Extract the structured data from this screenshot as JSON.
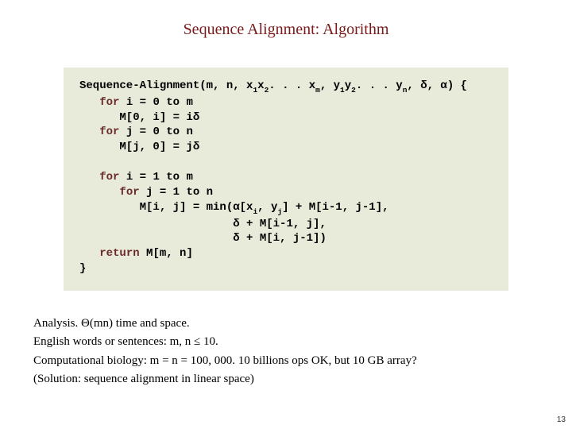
{
  "title": "Sequence Alignment:  Algorithm",
  "code": {
    "fn_name": "Sequence-Alignment",
    "p_open": "(m, n, x",
    "sub1": "1",
    "p_x2": "x",
    "sub2": "2",
    "p_dots_xm": ". . . x",
    "subm": "m",
    "p_comma_y": ", y",
    "suby1": "1",
    "p_y2": "y",
    "suby2": "2",
    "p_dots_yn": ". . . y",
    "subn": "n",
    "p_tail": ", δ, α) {",
    "kw_for": "for",
    "kw_return": "return",
    "l2": " i = 0 to m",
    "l3": "      M[0, i] = iδ",
    "l4": " j = 0 to n",
    "l5": "      M[j, 0] = jδ",
    "l6": " i = 1 to m",
    "l7": " j = 1 to n",
    "l8a": "         M[i, j] = min(α[x",
    "l8_subi": "i",
    "l8b": ", y",
    "l8_subj": "j",
    "l8c": "] + M[i-1, j-1],",
    "l9": "                       δ + M[i-1, j],",
    "l10": "                       δ + M[i, j-1])",
    "l11": " M[m, n]",
    "brace": "}"
  },
  "analysis": {
    "line1a": "Analysis.  Θ(mn) time and space.",
    "line2": "English words or sentences:  m, n  ≤ 10.",
    "line3": "Computational biology:  m = n = 100, 000. 10 billions ops OK, but 10 GB array?",
    "line4": "(Solution: sequence alignment in linear space)"
  },
  "pagenum": "13"
}
